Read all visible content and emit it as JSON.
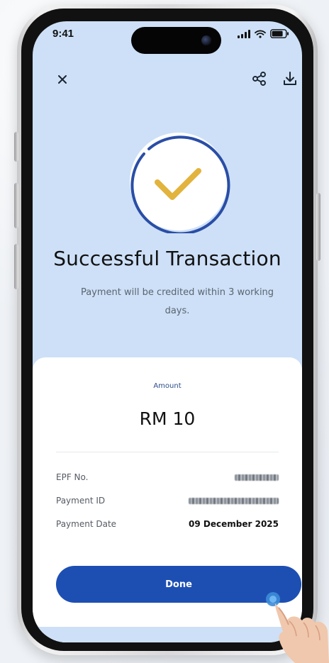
{
  "status_bar": {
    "time": "9:41",
    "icons": [
      "signal-icon",
      "wifi-icon",
      "battery-icon"
    ]
  },
  "topbar": {
    "close_icon": "close-icon",
    "share_icon": "share-icon",
    "download_icon": "download-icon"
  },
  "success": {
    "title": "Successful Transaction",
    "message": "Payment will be credited within 3 working days.",
    "icon": "check-circle-icon"
  },
  "summary": {
    "amount_label": "Amount",
    "amount_value": "RM 10",
    "rows": [
      {
        "label": "EPF No.",
        "value": ""
      },
      {
        "label": "Payment ID",
        "value": ""
      },
      {
        "label": "Payment Date",
        "value": "09 December 2025"
      }
    ]
  },
  "actions": {
    "done_label": "Done"
  },
  "colors": {
    "screen_background": "#cde0f7",
    "card_background": "#ffffff",
    "primary": "#1d4fb3",
    "success_check": "#e2b33d",
    "circle_stroke": "#2a4ea6"
  }
}
